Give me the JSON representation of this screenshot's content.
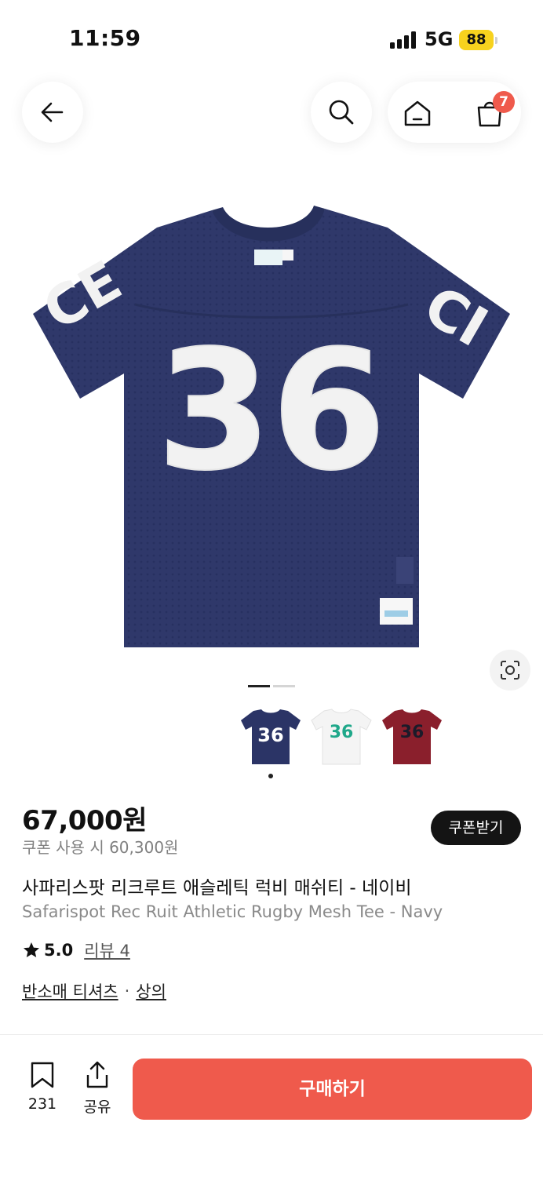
{
  "status": {
    "time": "11:59",
    "network": "5G",
    "battery": "88"
  },
  "header": {
    "back_icon": "arrow-left-icon",
    "search_icon": "search-icon",
    "home_icon": "home-icon",
    "cart_icon": "shopping-bag-icon",
    "cart_count": "7"
  },
  "product": {
    "jersey_number": "36",
    "price": "67,000원",
    "coupon_price": "쿠폰 사용 시 60,300원",
    "coupon_button": "쿠폰받기",
    "title_ko": "사파리스팟 리크루트 애슬레틱 럭비 매쉬티 - 네이비",
    "title_en": "Safarispot Rec Ruit Athletic Rugby Mesh Tee - Navy",
    "rating": "5.0",
    "reviews": "리뷰 4",
    "category": [
      "반소매 티셔츠",
      "상의"
    ],
    "category_separator": "·",
    "swatches": [
      {
        "color": "#2b3466",
        "number": "36",
        "number_color": "#ffffff"
      },
      {
        "color": "#f4f4f4",
        "number": "36",
        "number_color": "#1fa88a"
      },
      {
        "color": "#8a1f2c",
        "number": "36",
        "number_color": "#1b1b2a"
      }
    ]
  },
  "colors": {
    "navy": "#2e3768",
    "accent": "#ef5a4c",
    "dark_button": "#141414",
    "badge": "#ef5a4c"
  },
  "bottom": {
    "bookmark_count": "231",
    "share_label": "공유",
    "buy_label": "구매하기"
  }
}
